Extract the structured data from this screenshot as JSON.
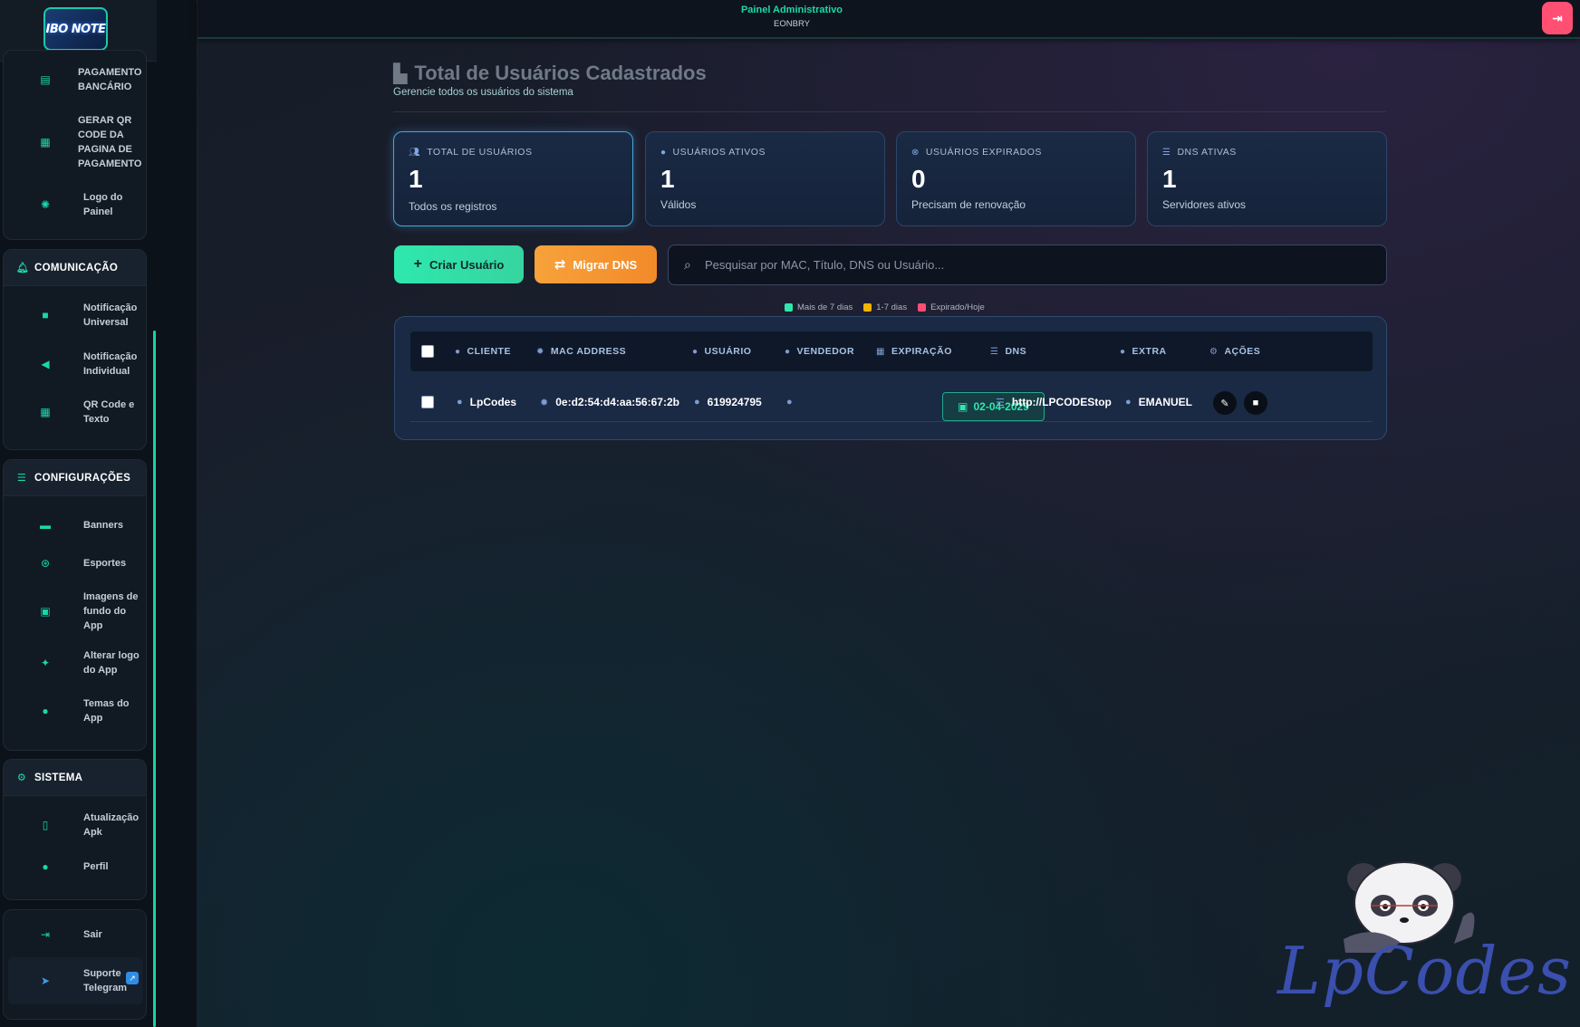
{
  "topbar": {
    "title": "Painel Administrativo",
    "subtitle": "EONBRY",
    "logout_icon": "logout-icon"
  },
  "logo": {
    "text": "IBO NOTE"
  },
  "sidebar": {
    "group_top": {
      "items": [
        {
          "label": "PAGAMENTO BANCÁRIO",
          "icon": "bank-icon"
        },
        {
          "label": "GERAR QR CODE DA PAGINA DE PAGAMENTO",
          "icon": "qrcode-icon"
        },
        {
          "label": "Logo do Painel",
          "icon": "aperture-icon"
        }
      ]
    },
    "comunicacao": {
      "title": "COMUNICAÇÃO",
      "items": [
        {
          "label": "Notificação Universal",
          "icon": "message-icon"
        },
        {
          "label": "Notificação Individual",
          "icon": "megaphone-icon"
        },
        {
          "label": "QR Code e Texto",
          "icon": "qrcode-icon"
        }
      ]
    },
    "configuracoes": {
      "title": "CONFIGURAÇÕES",
      "items": [
        {
          "label": "Banners",
          "icon": "image-icon"
        },
        {
          "label": "Esportes",
          "icon": "ball-icon"
        },
        {
          "label": "Imagens de fundo do App",
          "icon": "images-icon"
        },
        {
          "label": "Alterar logo do App",
          "icon": "sparkle-icon"
        },
        {
          "label": "Temas do App",
          "icon": "palette-icon"
        }
      ]
    },
    "sistema": {
      "title": "SISTEMA",
      "items": [
        {
          "label": "Atualização Apk",
          "icon": "mobile-icon"
        },
        {
          "label": "Perfil",
          "icon": "user-icon"
        }
      ]
    },
    "bottom": {
      "items": [
        {
          "label": "Sair",
          "icon": "logout-icon"
        },
        {
          "label": "Suporte Telegram",
          "icon": "telegram-icon"
        }
      ]
    }
  },
  "main": {
    "title": "Total de Usuários Cadastrados",
    "subtitle": "Gerencie todos os usuários do sistema",
    "stats": [
      {
        "label": "TOTAL DE USUÁRIOS",
        "value": "1",
        "desc": "Todos os registros",
        "icon": "users-icon"
      },
      {
        "label": "USUÁRIOS ATIVOS",
        "value": "1",
        "desc": "Válidos",
        "icon": "check-circle-icon"
      },
      {
        "label": "USUÁRIOS EXPIRADOS",
        "value": "0",
        "desc": "Precisam de renovação",
        "icon": "x-circle-icon"
      },
      {
        "label": "DNS ATIVAS",
        "value": "1",
        "desc": "Servidores ativos",
        "icon": "server-icon"
      }
    ],
    "buttons": {
      "create": "Criar Usuário",
      "migrate": "Migrar DNS"
    },
    "search": {
      "placeholder": "Pesquisar por MAC, Título, DNS ou Usuário...",
      "value": ""
    },
    "legend": [
      {
        "label": "Mais de 7 dias",
        "color": "#2ee8ad"
      },
      {
        "label": "1-7 dias",
        "color": "#f5b400"
      },
      {
        "label": "Expirado/Hoje",
        "color": "#ff4f73"
      }
    ],
    "table": {
      "columns": [
        "CLIENTE",
        "MAC ADDRESS",
        "USUÁRIO",
        "VENDEDOR",
        "EXPIRAÇÃO",
        "DNS",
        "EXTRA",
        "AÇÕES"
      ],
      "rows": [
        {
          "cliente": "LpCodes",
          "mac": "0e:d2:54:d4:aa:56:67:2b",
          "usuario": "619924795",
          "vendedor": "",
          "expiracao": "02-04-2029",
          "dns": "http://LPCODEStop",
          "extra": "EMANUEL"
        }
      ]
    }
  },
  "watermark": {
    "text": "LpCodes"
  },
  "colors": {
    "accent": "#1bd9ad",
    "create": "#2ee8ad",
    "migrate": "#f28a2a",
    "danger": "#ff4f73"
  }
}
